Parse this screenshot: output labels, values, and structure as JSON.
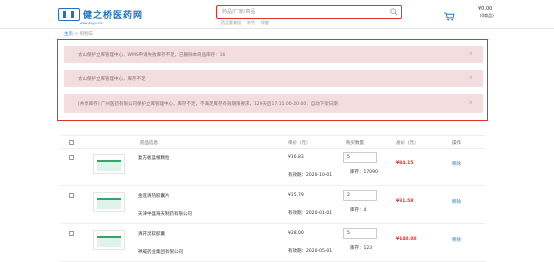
{
  "header": {
    "logo_text": "健之桥医药网",
    "logo_url": "www.jzqyy.com",
    "search_placeholder": "药品/厂家/商品",
    "hot_words": [
      "药品套餐组",
      "补钙",
      "保健"
    ],
    "cart_amount": "¥0.00",
    "cart_count": "(0商品)",
    "accent_color": "#1e73be",
    "alert_color": "#d9342b"
  },
  "breadcrumb": {
    "home": "主页",
    "sep": " > ",
    "current": "购物车"
  },
  "alerts": [
    {
      "text": "太山保护立库管理中心，WMS申请失败库存不足，已删除本商品库存：16",
      "close": "×"
    },
    {
      "text": "太山保护立库管理中心，库存不足",
      "close": "×"
    },
    {
      "text": "[共享库存] 广州医药有限公司保护立库管理中心，库存不足，不满足库存有效期限要求，129天后17:11.00-20:00：自动下架日期",
      "close": "×"
    }
  ],
  "table": {
    "columns": [
      "药品信息",
      "单价（元）",
      "购买数量",
      "总价（元）",
      "操作"
    ],
    "rows": [
      {
        "name": "复方板蓝根颗粒",
        "maker": "",
        "price": "¥16.83",
        "expiry": "有效期：2020-10-01",
        "qty": "5",
        "stock": "库存：17090",
        "total": "¥84.15",
        "action": "移除"
      },
      {
        "name": "金莲清热胶囊片",
        "maker": "天津中盛海天制药有限公司",
        "price": "¥15.79",
        "expiry": "有效期：2020-01-01",
        "qty": "2",
        "stock": "库存：4",
        "total": "¥31.58",
        "action": "移除"
      },
      {
        "name": "清开灵软胶囊",
        "maker": "神威药业集团有限公司",
        "price": "¥28.00",
        "expiry": "有效期：2020-05-01",
        "qty": "5",
        "stock": "库存：123",
        "total": "¥140.00",
        "action": "移除"
      }
    ]
  }
}
